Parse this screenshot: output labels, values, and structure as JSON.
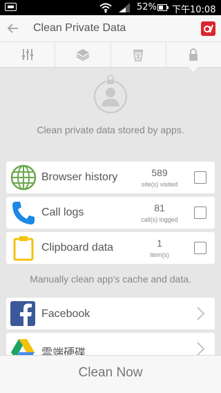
{
  "status_bar": {
    "battery": "52%",
    "time": "下午10:08"
  },
  "header": {
    "title": "Clean Private Data"
  },
  "tabs": [
    {
      "icon": "sliders-icon"
    },
    {
      "icon": "layers-icon"
    },
    {
      "icon": "trash-icon"
    },
    {
      "icon": "lock-icon",
      "active": true
    }
  ],
  "hero": {
    "text": "Clean private data stored by apps."
  },
  "items": [
    {
      "label": "Browser history",
      "count": "589",
      "unit": "site(s) visited",
      "icon": "globe-icon"
    },
    {
      "label": "Call logs",
      "count": "81",
      "unit": "call(s) logged",
      "icon": "phone-icon"
    },
    {
      "label": "Clipboard data",
      "count": "1",
      "unit": "item(s)",
      "icon": "clipboard-icon"
    }
  ],
  "manual_text": "Manually clean app's cache and data.",
  "apps": [
    {
      "label": "Facebook",
      "icon": "facebook-icon"
    },
    {
      "label": "雲端硬碟",
      "icon": "google-drive-icon"
    }
  ],
  "bottom_button": "Clean Now",
  "colors": {
    "accent_red": "#d8262e",
    "globe_green": "#6aa84f",
    "phone_blue": "#1e88e5",
    "clipboard_yellow": "#f4c20d",
    "facebook_blue": "#3b5998"
  }
}
